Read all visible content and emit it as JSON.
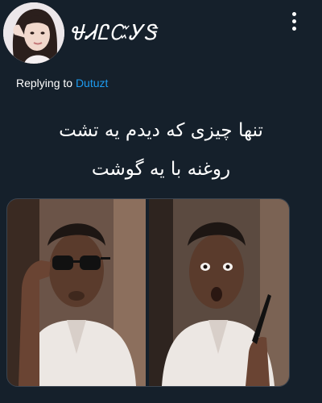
{
  "user": {
    "display_name": "ᏠᏗᏝᏨᎩᏕ",
    "avatar_icon": "profile-photo-avatar"
  },
  "header": {
    "more_icon": "vertical-ellipsis-icon"
  },
  "reply": {
    "prefix": "Replying to",
    "handle": "Dutuzt"
  },
  "tweet": {
    "lines": [
      "تنها چیزی که دیدم یه تشت",
      "روغنه با یه گوشت"
    ]
  },
  "colors": {
    "background": "#15202b",
    "text": "#ffffff",
    "link": "#1d9bf0"
  }
}
